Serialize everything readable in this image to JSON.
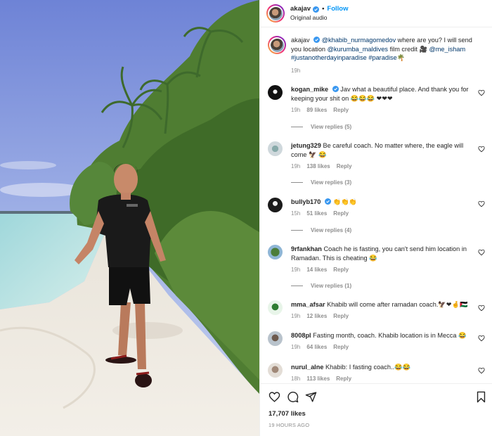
{
  "post": {
    "author": "akajav",
    "follow_label": "Follow",
    "separator": "•",
    "audio": "Original audio"
  },
  "caption": {
    "username": "akajav",
    "parts": {
      "m1": "@khabib_nurmagomedov",
      "t1": " where are you? I will send you location ",
      "m2": "@kurumba_maldives",
      "t2": " film credit 🎥 ",
      "m3": "@me_isham",
      "t3": " ",
      "m4": "#justanotherdayinparadise",
      "t4": " ",
      "m5": "#paradise🌴"
    },
    "time": "19h"
  },
  "comments": [
    {
      "username": "kogan_mike",
      "verified": true,
      "text": "Jav what a beautiful place. And thank you for keeping your shit on 😂😂😂 ❤❤❤",
      "time": "19h",
      "likes": "89 likes",
      "reply": "Reply",
      "view_replies": "View replies (5)"
    },
    {
      "username": "jetung329",
      "verified": false,
      "text": "Be careful coach. No matter where, the eagle will come 🦅 😂",
      "time": "19h",
      "likes": "138 likes",
      "reply": "Reply",
      "view_replies": "View replies (3)"
    },
    {
      "username": "bullyb170",
      "verified": true,
      "text": "👏👏👏",
      "time": "15h",
      "likes": "51 likes",
      "reply": "Reply",
      "view_replies": "View replies (4)"
    },
    {
      "username": "9rfankhan",
      "verified": false,
      "text": "Coach he is fasting, you can't send him location in Ramadan. This is cheating 😂",
      "time": "19h",
      "likes": "14 likes",
      "reply": "Reply",
      "view_replies": "View replies (1)"
    },
    {
      "username": "mma_afsar",
      "verified": false,
      "text": "Khabib will come after ramadan coach.🦅❤🤞🇵🇸",
      "time": "19h",
      "likes": "12 likes",
      "reply": "Reply",
      "view_replies": ""
    },
    {
      "username": "8008pl",
      "verified": false,
      "text": "Fasting month, coach. Khabib location is in Mecca 😂",
      "time": "19h",
      "likes": "64 likes",
      "reply": "Reply",
      "view_replies": ""
    },
    {
      "username": "nurul_alne",
      "verified": false,
      "text": "Khabib: I fasting coach..😂😂",
      "time": "18h",
      "likes": "113 likes",
      "reply": "Reply",
      "view_replies": ""
    }
  ],
  "footer": {
    "likes": "17,707 likes",
    "posted": "19 HOURS AGO"
  },
  "icons": [
    "heart-icon",
    "comment-icon",
    "share-icon",
    "save-icon",
    "verified-icon",
    "more-icon"
  ],
  "colors": {
    "link": "#0095f6",
    "mention": "#00376b",
    "muted": "#8e8e8e",
    "verified": "#3897f0"
  }
}
